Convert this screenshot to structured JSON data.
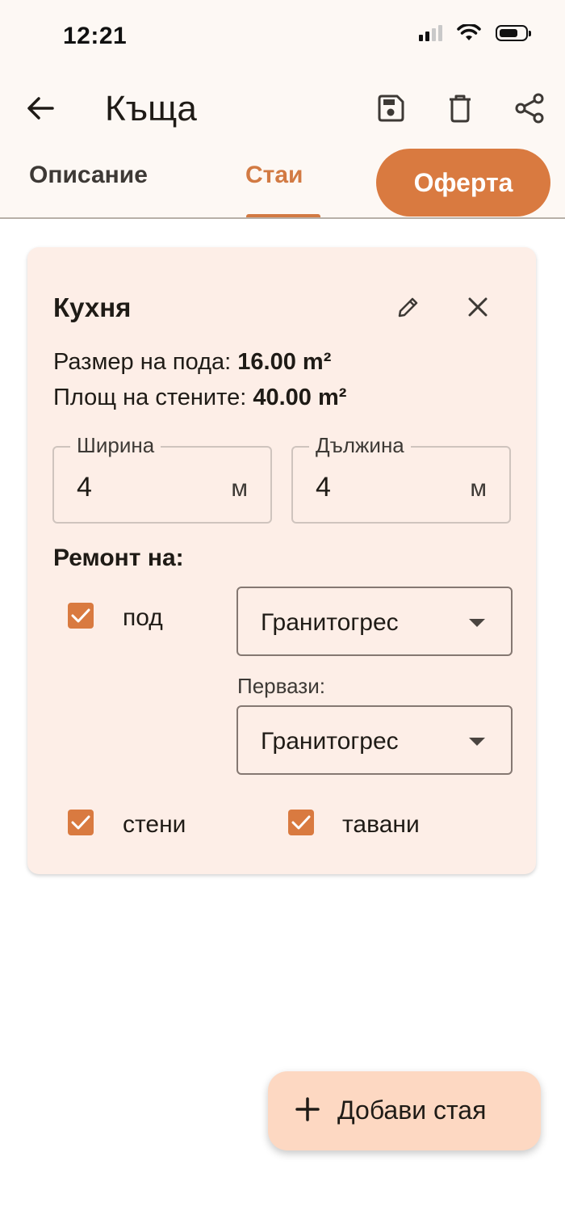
{
  "status": {
    "time": "12:21"
  },
  "header": {
    "title": "Къща"
  },
  "tabs": [
    {
      "label": "Описание",
      "active": false
    },
    {
      "label": "Стаи",
      "active": true
    },
    {
      "label": "Оферта",
      "active": false
    }
  ],
  "room": {
    "name": "Кухня",
    "floor_size_label": "Размер на пода:",
    "floor_size_value": "16.00 m²",
    "wall_area_label": "Площ на стените:",
    "wall_area_value": "40.00 m²",
    "width": {
      "label": "Ширина",
      "value": "4",
      "unit": "м"
    },
    "length": {
      "label": "Дължина",
      "value": "4",
      "unit": "м"
    },
    "repair_title": "Ремонт на:",
    "floor": {
      "label": "под",
      "checked": true,
      "material": "Гранитогрес"
    },
    "baseboards": {
      "label": "Первази:",
      "material": "Гранитогрес"
    },
    "walls": {
      "label": "стени",
      "checked": true
    },
    "ceilings": {
      "label": "тавани",
      "checked": true
    }
  },
  "fab": {
    "label": "Добави стая"
  },
  "colors": {
    "accent": "#d97a40",
    "card": "#fdeee7",
    "fab": "#fdd8c2"
  }
}
